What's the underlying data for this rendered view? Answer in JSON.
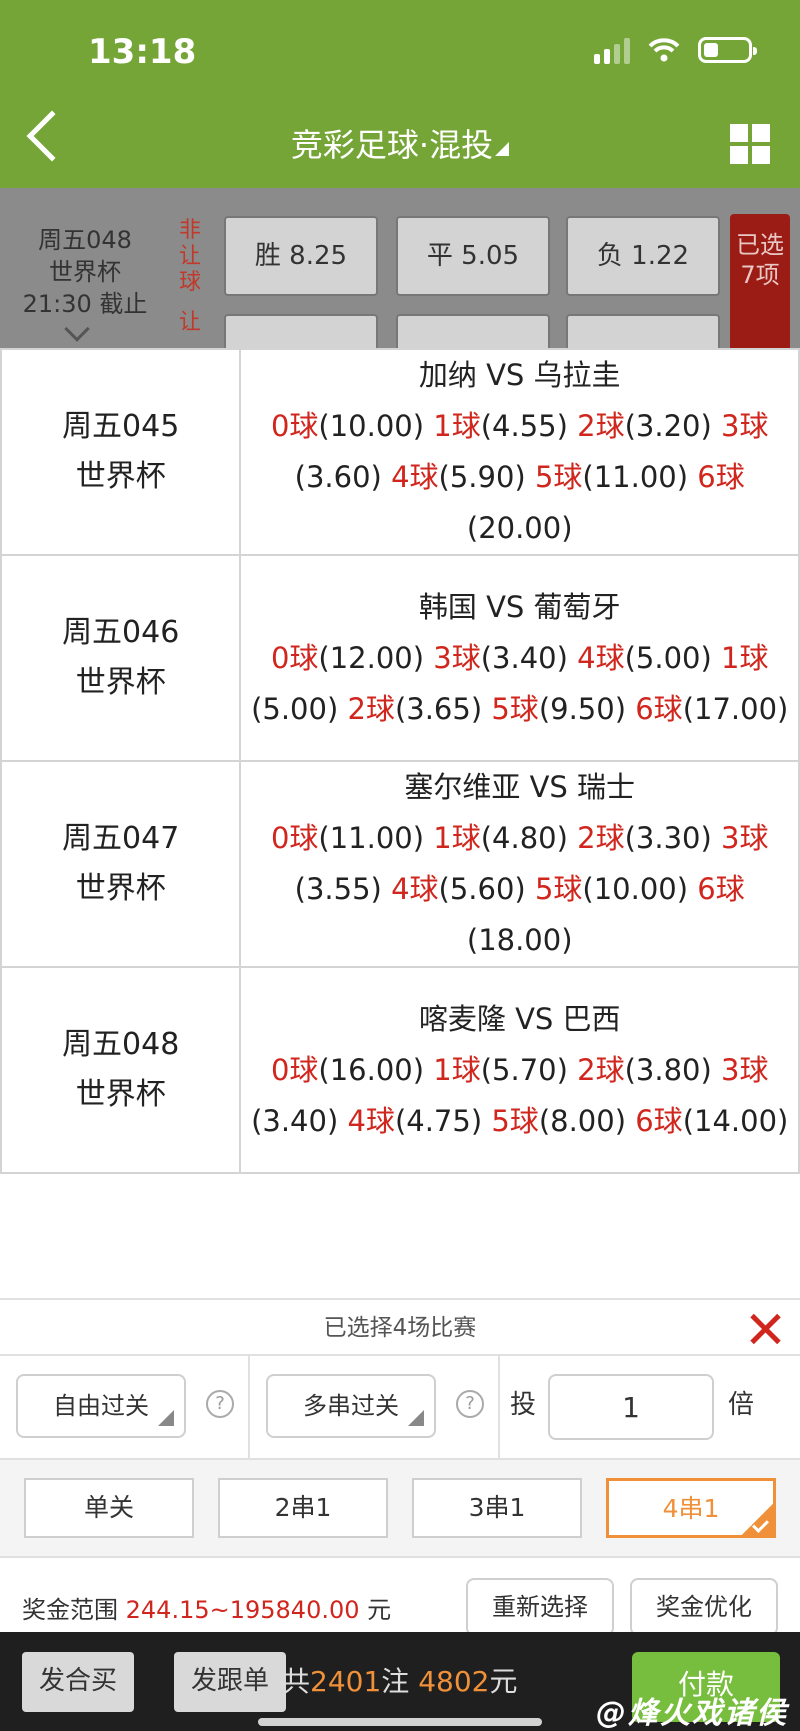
{
  "status": {
    "time": "13:18"
  },
  "header": {
    "title": "竞彩足球·混投"
  },
  "background_match": {
    "line1": "周五048",
    "line2": "世界杯",
    "line3": "21:30 截止",
    "tag": "非让球",
    "tag2": "让",
    "win": "胜 8.25",
    "draw": "平 5.05",
    "lose": "负 1.22",
    "selected": "已选7项"
  },
  "matches": [
    {
      "id": "周五045",
      "league": "世界杯",
      "teams": "加纳 VS 乌拉圭",
      "goals": [
        {
          "g": "0球",
          "o": "(10.00)"
        },
        {
          "g": "1球",
          "o": "(4.55)"
        },
        {
          "g": "2球",
          "o": "(3.20)"
        },
        {
          "g": "3球",
          "o": "(3.60)"
        },
        {
          "g": "4球",
          "o": "(5.90)"
        },
        {
          "g": "5球",
          "o": "(11.00)"
        },
        {
          "g": "6球",
          "o": "(20.00)"
        }
      ]
    },
    {
      "id": "周五046",
      "league": "世界杯",
      "teams": "韩国 VS 葡萄牙",
      "goals": [
        {
          "g": "0球",
          "o": "(12.00)"
        },
        {
          "g": "3球",
          "o": "(3.40)"
        },
        {
          "g": "4球",
          "o": "(5.00)"
        },
        {
          "g": "1球",
          "o": "(5.00)"
        },
        {
          "g": "2球",
          "o": "(3.65)"
        },
        {
          "g": "5球",
          "o": "(9.50)"
        },
        {
          "g": "6球",
          "o": "(17.00)"
        }
      ]
    },
    {
      "id": "周五047",
      "league": "世界杯",
      "teams": "塞尔维亚 VS 瑞士",
      "goals": [
        {
          "g": "0球",
          "o": "(11.00)"
        },
        {
          "g": "1球",
          "o": "(4.80)"
        },
        {
          "g": "2球",
          "o": "(3.30)"
        },
        {
          "g": "3球",
          "o": "(3.55)"
        },
        {
          "g": "4球",
          "o": "(5.60)"
        },
        {
          "g": "5球",
          "o": "(10.00)"
        },
        {
          "g": "6球",
          "o": "(18.00)"
        }
      ]
    },
    {
      "id": "周五048",
      "league": "世界杯",
      "teams": "喀麦隆 VS 巴西",
      "goals": [
        {
          "g": "0球",
          "o": "(16.00)"
        },
        {
          "g": "1球",
          "o": "(5.70)"
        },
        {
          "g": "2球",
          "o": "(3.80)"
        },
        {
          "g": "3球",
          "o": "(3.40)"
        },
        {
          "g": "4球",
          "o": "(4.75)"
        },
        {
          "g": "5球",
          "o": "(8.00)"
        },
        {
          "g": "6球",
          "o": "(14.00)"
        }
      ]
    }
  ],
  "panel": {
    "selected_text": "已选择4场比赛",
    "free_pass": "自由过关",
    "multi_pass": "多串过关",
    "tou": "投",
    "multiple": "1",
    "bei": "倍",
    "pass_options": [
      "单关",
      "2串1",
      "3串1",
      "4串1"
    ],
    "prize_label": "奖金范围",
    "prize_range": "244.15~195840.00",
    "prize_unit": "元",
    "reset": "重新选择",
    "optimize": "奖金优化"
  },
  "footer": {
    "group_buy": "发合买",
    "follow": "发跟单",
    "prefix": "共",
    "bets": "2401",
    "bets_unit": "注",
    "amount": "4802",
    "amount_unit": "元",
    "pay": "付款"
  },
  "watermark": "@烽火戏诸侯",
  "colors": {
    "header": "#74a536",
    "accent_red": "#d0261d",
    "accent_orange": "#f0913a",
    "pay_green": "#77bd3e"
  }
}
